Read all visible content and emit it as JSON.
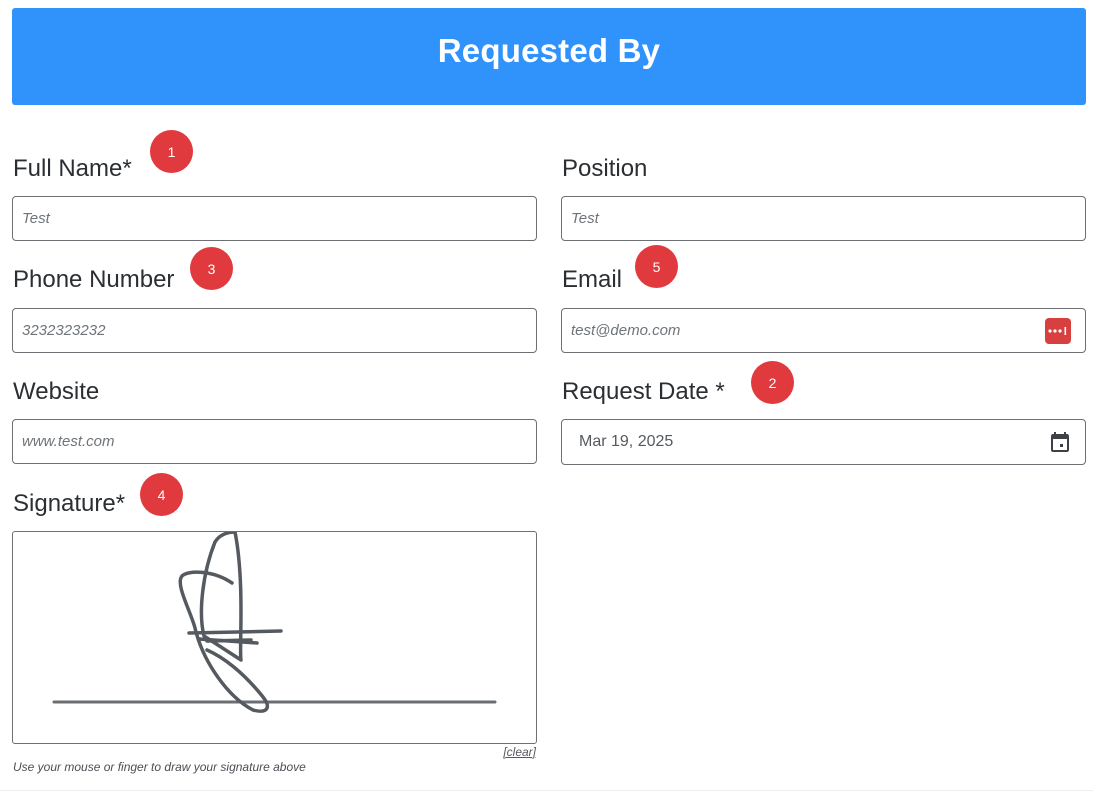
{
  "header": {
    "title": "Requested By"
  },
  "fields": {
    "full_name": {
      "label": "Full Name*",
      "value": "Test"
    },
    "position": {
      "label": "Position",
      "value": "Test"
    },
    "phone": {
      "label": "Phone Number",
      "value": "3232323232"
    },
    "email": {
      "label": "Email",
      "value": "test@demo.com",
      "icon": "password-manager-icon"
    },
    "website": {
      "label": "Website",
      "value": "www.test.com"
    },
    "request_date": {
      "label": "Request Date *",
      "value": "Mar 19, 2025",
      "icon": "calendar-icon"
    },
    "signature": {
      "label": "Signature*",
      "clear_label": "[clear]",
      "hint": "Use your mouse or finger to draw your signature above"
    }
  },
  "badges": {
    "full_name": "1",
    "request_date": "2",
    "phone": "3",
    "signature": "4",
    "email": "5"
  },
  "colors": {
    "header_bg": "#3092fb",
    "badge_bg": "#e03a3e",
    "password_icon_bg": "#d7403f",
    "border": "#6c6f73"
  }
}
